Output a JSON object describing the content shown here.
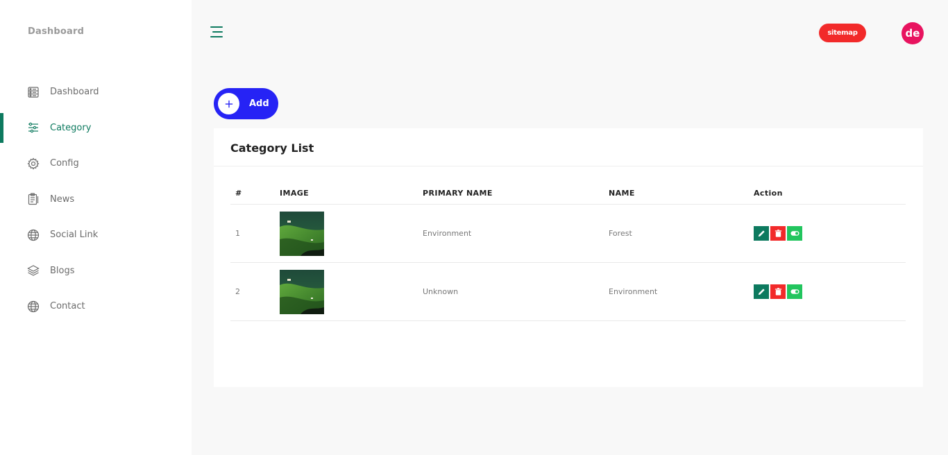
{
  "sidebar": {
    "brand": "Dashboard",
    "items": [
      {
        "label": "Dashboard",
        "icon": "dashboard-icon",
        "active": false
      },
      {
        "label": "Category",
        "icon": "sliders-icon",
        "active": true
      },
      {
        "label": "Config",
        "icon": "gear-icon",
        "active": false
      },
      {
        "label": "News",
        "icon": "clipboard-icon",
        "active": false
      },
      {
        "label": "Social Link",
        "icon": "globe-icon",
        "active": false
      },
      {
        "label": "Blogs",
        "icon": "layers-icon",
        "active": false
      },
      {
        "label": "Contact",
        "icon": "globe-icon",
        "active": false
      }
    ]
  },
  "header": {
    "menu_icon": "hamburger-icon",
    "sitemap_label": "sitemap",
    "avatar_initials": "de"
  },
  "toolbar": {
    "add_label": "Add",
    "add_icon": "plus-icon"
  },
  "card": {
    "title": "Category List",
    "columns": [
      "#",
      "IMAGE",
      "PRIMARY NAME",
      "NAME",
      "Action"
    ],
    "rows": [
      {
        "num": "1",
        "primary_name": "Environment",
        "name": "Forest"
      },
      {
        "num": "2",
        "primary_name": "Unknown",
        "name": "Environment"
      }
    ]
  },
  "colors": {
    "accent": "#0d7a5f",
    "add_button": "#2623f5",
    "danger": "#f22a2a",
    "toggle": "#22c55e",
    "avatar": "#e8135f"
  }
}
